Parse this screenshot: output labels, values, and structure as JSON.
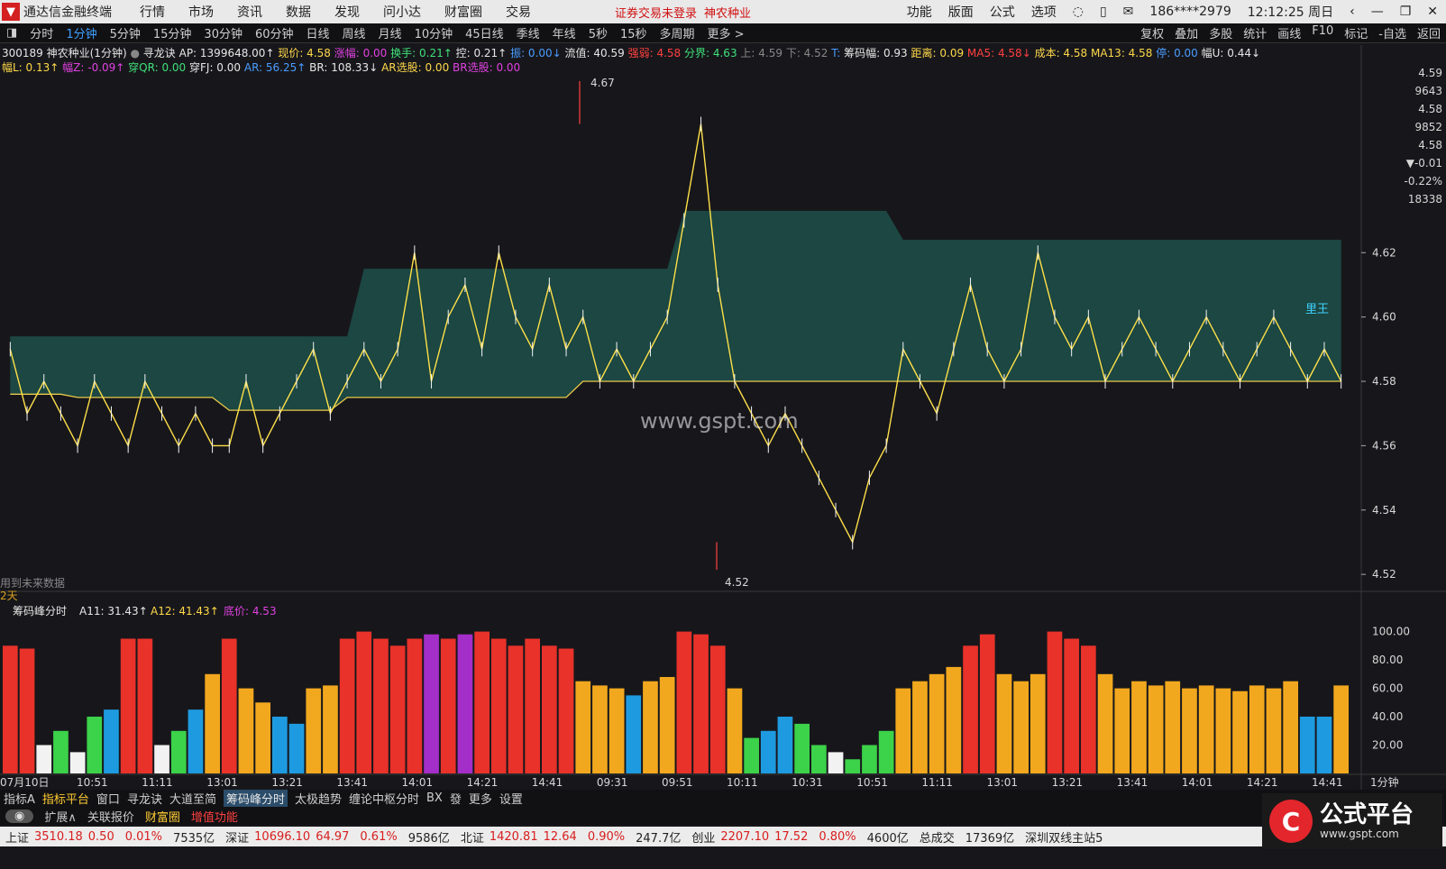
{
  "app": {
    "name": "通达信金融终端",
    "menus": [
      "行情",
      "市场",
      "资讯",
      "数据",
      "发现",
      "问小达",
      "财富圈",
      "交易"
    ],
    "alert": "证券交易未登录",
    "alert_stock": "神农种业",
    "right_menus": [
      "功能",
      "版面",
      "公式",
      "选项"
    ],
    "user": "186****2979",
    "clock": "12:12:25 周日"
  },
  "periods": [
    "分时",
    "1分钟",
    "5分钟",
    "15分钟",
    "30分钟",
    "60分钟",
    "日线",
    "周线",
    "月线",
    "10分钟",
    "45日线",
    "季线",
    "年线",
    "5秒",
    "15秒",
    "多周期",
    "更多 >"
  ],
  "active_period": "1分钟",
  "tools": [
    "复权",
    "叠加",
    "多股",
    "统计",
    "画线",
    "F10",
    "标记",
    "-自选",
    "返回"
  ],
  "info_line1": {
    "code": "300189 神农种业(1分钟)",
    "indicator": "寻龙诀",
    "ap": "AP: 1399648.00↑",
    "xianjia": "现价: 4.58",
    "zhangfu": "涨幅: 0.00",
    "huanshou": "换手: 0.21↑",
    "kong": "控: 0.21↑",
    "zhen": "振: 0.00↓",
    "liuzhi": "流值: 40.59",
    "qiangruo": "强弱: 4.58",
    "fenjie": "分界: 4.63",
    "shang": "上: 4.59",
    "xia": "下: 4.52",
    "t": "T:",
    "choumafu": "筹码幅: 0.93",
    "juli": "距离: 0.09",
    "ma5": "MA5: 4.58↓",
    "chengben": "成本: 4.58",
    "ma13": "MA13: 4.58",
    "ting": "停: 0.00",
    "fuu": "幅U: 0.44↓"
  },
  "info_line2": {
    "fuL": "幅L: 0.13↑",
    "fuZ": "幅Z: -0.09↑",
    "qr": "穿QR: 0.00",
    "fj": "穿FJ: 0.00",
    "ar": "AR: 56.25↑",
    "br": "BR: 108.33↓",
    "arxg": "AR选股: 0.00",
    "brxg": "BR选股: 0.00"
  },
  "chart_data": [
    {
      "type": "line",
      "title": "300189 神农种业(1分钟)",
      "y_ticks": [
        4.52,
        4.54,
        4.56,
        4.58,
        4.6,
        4.62
      ],
      "ylim": [
        4.515,
        4.675
      ],
      "price_annotations": {
        "high": "4.67",
        "low": "4.52"
      },
      "x_ticks": [
        "07月10日",
        "10:51",
        "11:11",
        "13:01",
        "13:21",
        "13:41",
        "14:01",
        "14:21",
        "14:41",
        "09:31",
        "09:51",
        "10:11",
        "10:31",
        "10:51",
        "11:11",
        "13:01",
        "13:21",
        "13:41",
        "14:01",
        "14:21",
        "14:41",
        "1分钟"
      ],
      "series": [
        {
          "name": "现价",
          "values": [
            4.59,
            4.57,
            4.58,
            4.57,
            4.56,
            4.58,
            4.57,
            4.56,
            4.58,
            4.57,
            4.56,
            4.57,
            4.56,
            4.56,
            4.58,
            4.56,
            4.57,
            4.58,
            4.59,
            4.57,
            4.58,
            4.59,
            4.58,
            4.59,
            4.62,
            4.58,
            4.6,
            4.61,
            4.59,
            4.62,
            4.6,
            4.59,
            4.61,
            4.59,
            4.6,
            4.58,
            4.59,
            4.58,
            4.59,
            4.6,
            4.63,
            4.66,
            4.61,
            4.58,
            4.57,
            4.56,
            4.57,
            4.56,
            4.55,
            4.54,
            4.53,
            4.55,
            4.56,
            4.59,
            4.58,
            4.57,
            4.59,
            4.61,
            4.59,
            4.58,
            4.59,
            4.62,
            4.6,
            4.59,
            4.6,
            4.58,
            4.59,
            4.6,
            4.59,
            4.58,
            4.59,
            4.6,
            4.59,
            4.58,
            4.59,
            4.6,
            4.59,
            4.58,
            4.59,
            4.58
          ]
        }
      ],
      "chip_band_upper": [
        4.594,
        4.594,
        4.594,
        4.594,
        4.594,
        4.594,
        4.594,
        4.594,
        4.594,
        4.594,
        4.594,
        4.594,
        4.594,
        4.594,
        4.594,
        4.594,
        4.594,
        4.594,
        4.594,
        4.594,
        4.594,
        4.615,
        4.615,
        4.615,
        4.615,
        4.615,
        4.615,
        4.615,
        4.615,
        4.615,
        4.615,
        4.615,
        4.615,
        4.615,
        4.615,
        4.615,
        4.615,
        4.615,
        4.615,
        4.615,
        4.633,
        4.633,
        4.633,
        4.633,
        4.633,
        4.633,
        4.633,
        4.633,
        4.633,
        4.633,
        4.633,
        4.633,
        4.633,
        4.624,
        4.624,
        4.624,
        4.624,
        4.624,
        4.624,
        4.624,
        4.624,
        4.624,
        4.624,
        4.624,
        4.624,
        4.624,
        4.624,
        4.624,
        4.624,
        4.624,
        4.624,
        4.624,
        4.624,
        4.624,
        4.624,
        4.624,
        4.624,
        4.624,
        4.624,
        4.624
      ],
      "chip_band_lower": [
        4.576,
        4.576,
        4.576,
        4.576,
        4.575,
        4.575,
        4.575,
        4.575,
        4.575,
        4.575,
        4.575,
        4.575,
        4.575,
        4.571,
        4.571,
        4.571,
        4.571,
        4.571,
        4.571,
        4.571,
        4.575,
        4.575,
        4.575,
        4.575,
        4.575,
        4.575,
        4.575,
        4.575,
        4.575,
        4.575,
        4.575,
        4.575,
        4.575,
        4.575,
        4.58,
        4.58,
        4.58,
        4.58,
        4.58,
        4.58,
        4.58,
        4.58,
        4.58,
        4.58,
        4.58,
        4.58,
        4.58,
        4.58,
        4.58,
        4.58,
        4.58,
        4.58,
        4.58,
        4.58,
        4.58,
        4.58,
        4.58,
        4.58,
        4.58,
        4.58,
        4.58,
        4.58,
        4.58,
        4.58,
        4.58,
        4.58,
        4.58,
        4.58,
        4.58,
        4.58,
        4.58,
        4.58,
        4.58,
        4.58,
        4.58,
        4.58,
        4.58,
        4.58,
        4.58,
        4.58
      ],
      "right_mini": [
        "4.59",
        "9643",
        "4.58",
        "9852",
        "4.58",
        "▼-0.01",
        "-0.22%",
        "18338"
      ]
    },
    {
      "type": "bar",
      "title": "筹码峰分时",
      "a11": "A11: 31.43↑",
      "a12": "A12: 41.43↑",
      "dijia": "底价: 4.53",
      "y_ticks": [
        20.0,
        40.0,
        60.0,
        80.0,
        100.0
      ],
      "ylim": [
        0,
        108
      ],
      "values": [
        90,
        88,
        20,
        30,
        15,
        40,
        45,
        95,
        95,
        20,
        30,
        45,
        70,
        95,
        60,
        50,
        40,
        35,
        60,
        62,
        95,
        100,
        95,
        90,
        95,
        98,
        95,
        98,
        100,
        95,
        90,
        95,
        90,
        88,
        65,
        62,
        60,
        55,
        65,
        68,
        100,
        98,
        90,
        60,
        25,
        30,
        40,
        35,
        20,
        15,
        10,
        20,
        30,
        60,
        65,
        70,
        75,
        90,
        98,
        70,
        65,
        70,
        100,
        95,
        90,
        70,
        60,
        65,
        62,
        65,
        60,
        62,
        60,
        58,
        62,
        60,
        65,
        40,
        40,
        62
      ],
      "colors": [
        "#e8322a",
        "#e8322a",
        "#f2f2f2",
        "#3cd24a",
        "#f2f2f2",
        "#3cd24a",
        "#1e9be0",
        "#e8322a",
        "#e8322a",
        "#f2f2f2",
        "#3cd24a",
        "#1e9be0",
        "#f2a81e",
        "#e8322a",
        "#f2a81e",
        "#f2a81e",
        "#1e9be0",
        "#1e9be0",
        "#f2a81e",
        "#f2a81e",
        "#e8322a",
        "#e8322a",
        "#e8322a",
        "#e8322a",
        "#e8322a",
        "#a42ec8",
        "#e8322a",
        "#a42ec8",
        "#e8322a",
        "#e8322a",
        "#e8322a",
        "#e8322a",
        "#e8322a",
        "#e8322a",
        "#f2a81e",
        "#f2a81e",
        "#f2a81e",
        "#1e9be0",
        "#f2a81e",
        "#f2a81e",
        "#e8322a",
        "#e8322a",
        "#e8322a",
        "#f2a81e",
        "#3cd24a",
        "#1e9be0",
        "#1e9be0",
        "#3cd24a",
        "#3cd24a",
        "#f2f2f2",
        "#3cd24a",
        "#3cd24a",
        "#3cd24a",
        "#f2a81e",
        "#f2a81e",
        "#f2a81e",
        "#f2a81e",
        "#e8322a",
        "#e8322a",
        "#f2a81e",
        "#f2a81e",
        "#f2a81e",
        "#e8322a",
        "#e8322a",
        "#e8322a",
        "#f2a81e",
        "#f2a81e",
        "#f2a81e",
        "#f2a81e",
        "#f2a81e",
        "#f2a81e",
        "#f2a81e",
        "#f2a81e",
        "#f2a81e",
        "#f2a81e",
        "#f2a81e",
        "#f2a81e",
        "#1e9be0",
        "#1e9be0",
        "#f2a81e"
      ]
    }
  ],
  "overlay": {
    "watermark": "www.gspt.com",
    "future_note": "用到未来数据",
    "days": "2天",
    "label_wang": "里王"
  },
  "lower_tabs": [
    "指标A",
    "指标平台",
    "窗口",
    "寻龙诀",
    "大道至简",
    "筹码峰分时",
    "太极趋势",
    "缠论中枢分时",
    "BX",
    "發",
    "更多",
    "设置"
  ],
  "active_lower_tab": "指标平台",
  "link_bar": [
    "扩展∧",
    "关联报价",
    "财富圈",
    "增值功能"
  ],
  "status": {
    "sh": "上证",
    "sh_val": "3510.18",
    "sh_chg": "0.50",
    "sh_pct": "0.01%",
    "sh_amt": "7535亿",
    "sz": "深证",
    "sz_val": "10696.10",
    "sz_chg": "64.97",
    "sz_pct": "0.61%",
    "sz_amt": "9586亿",
    "bz": "北证",
    "bz_val": "1420.81",
    "bz_chg": "12.64",
    "bz_pct": "0.90%",
    "bz_amt": "247.7亿",
    "cy": "创业",
    "cy_val": "2207.10",
    "cy_chg": "17.52",
    "cy_pct": "0.80%",
    "cy_amt": "4600亿",
    "total": "总成交",
    "total_amt": "17369亿",
    "server": "深圳双线主站5"
  },
  "brand": {
    "title": "公式平台",
    "url": "www.gspt.com"
  }
}
